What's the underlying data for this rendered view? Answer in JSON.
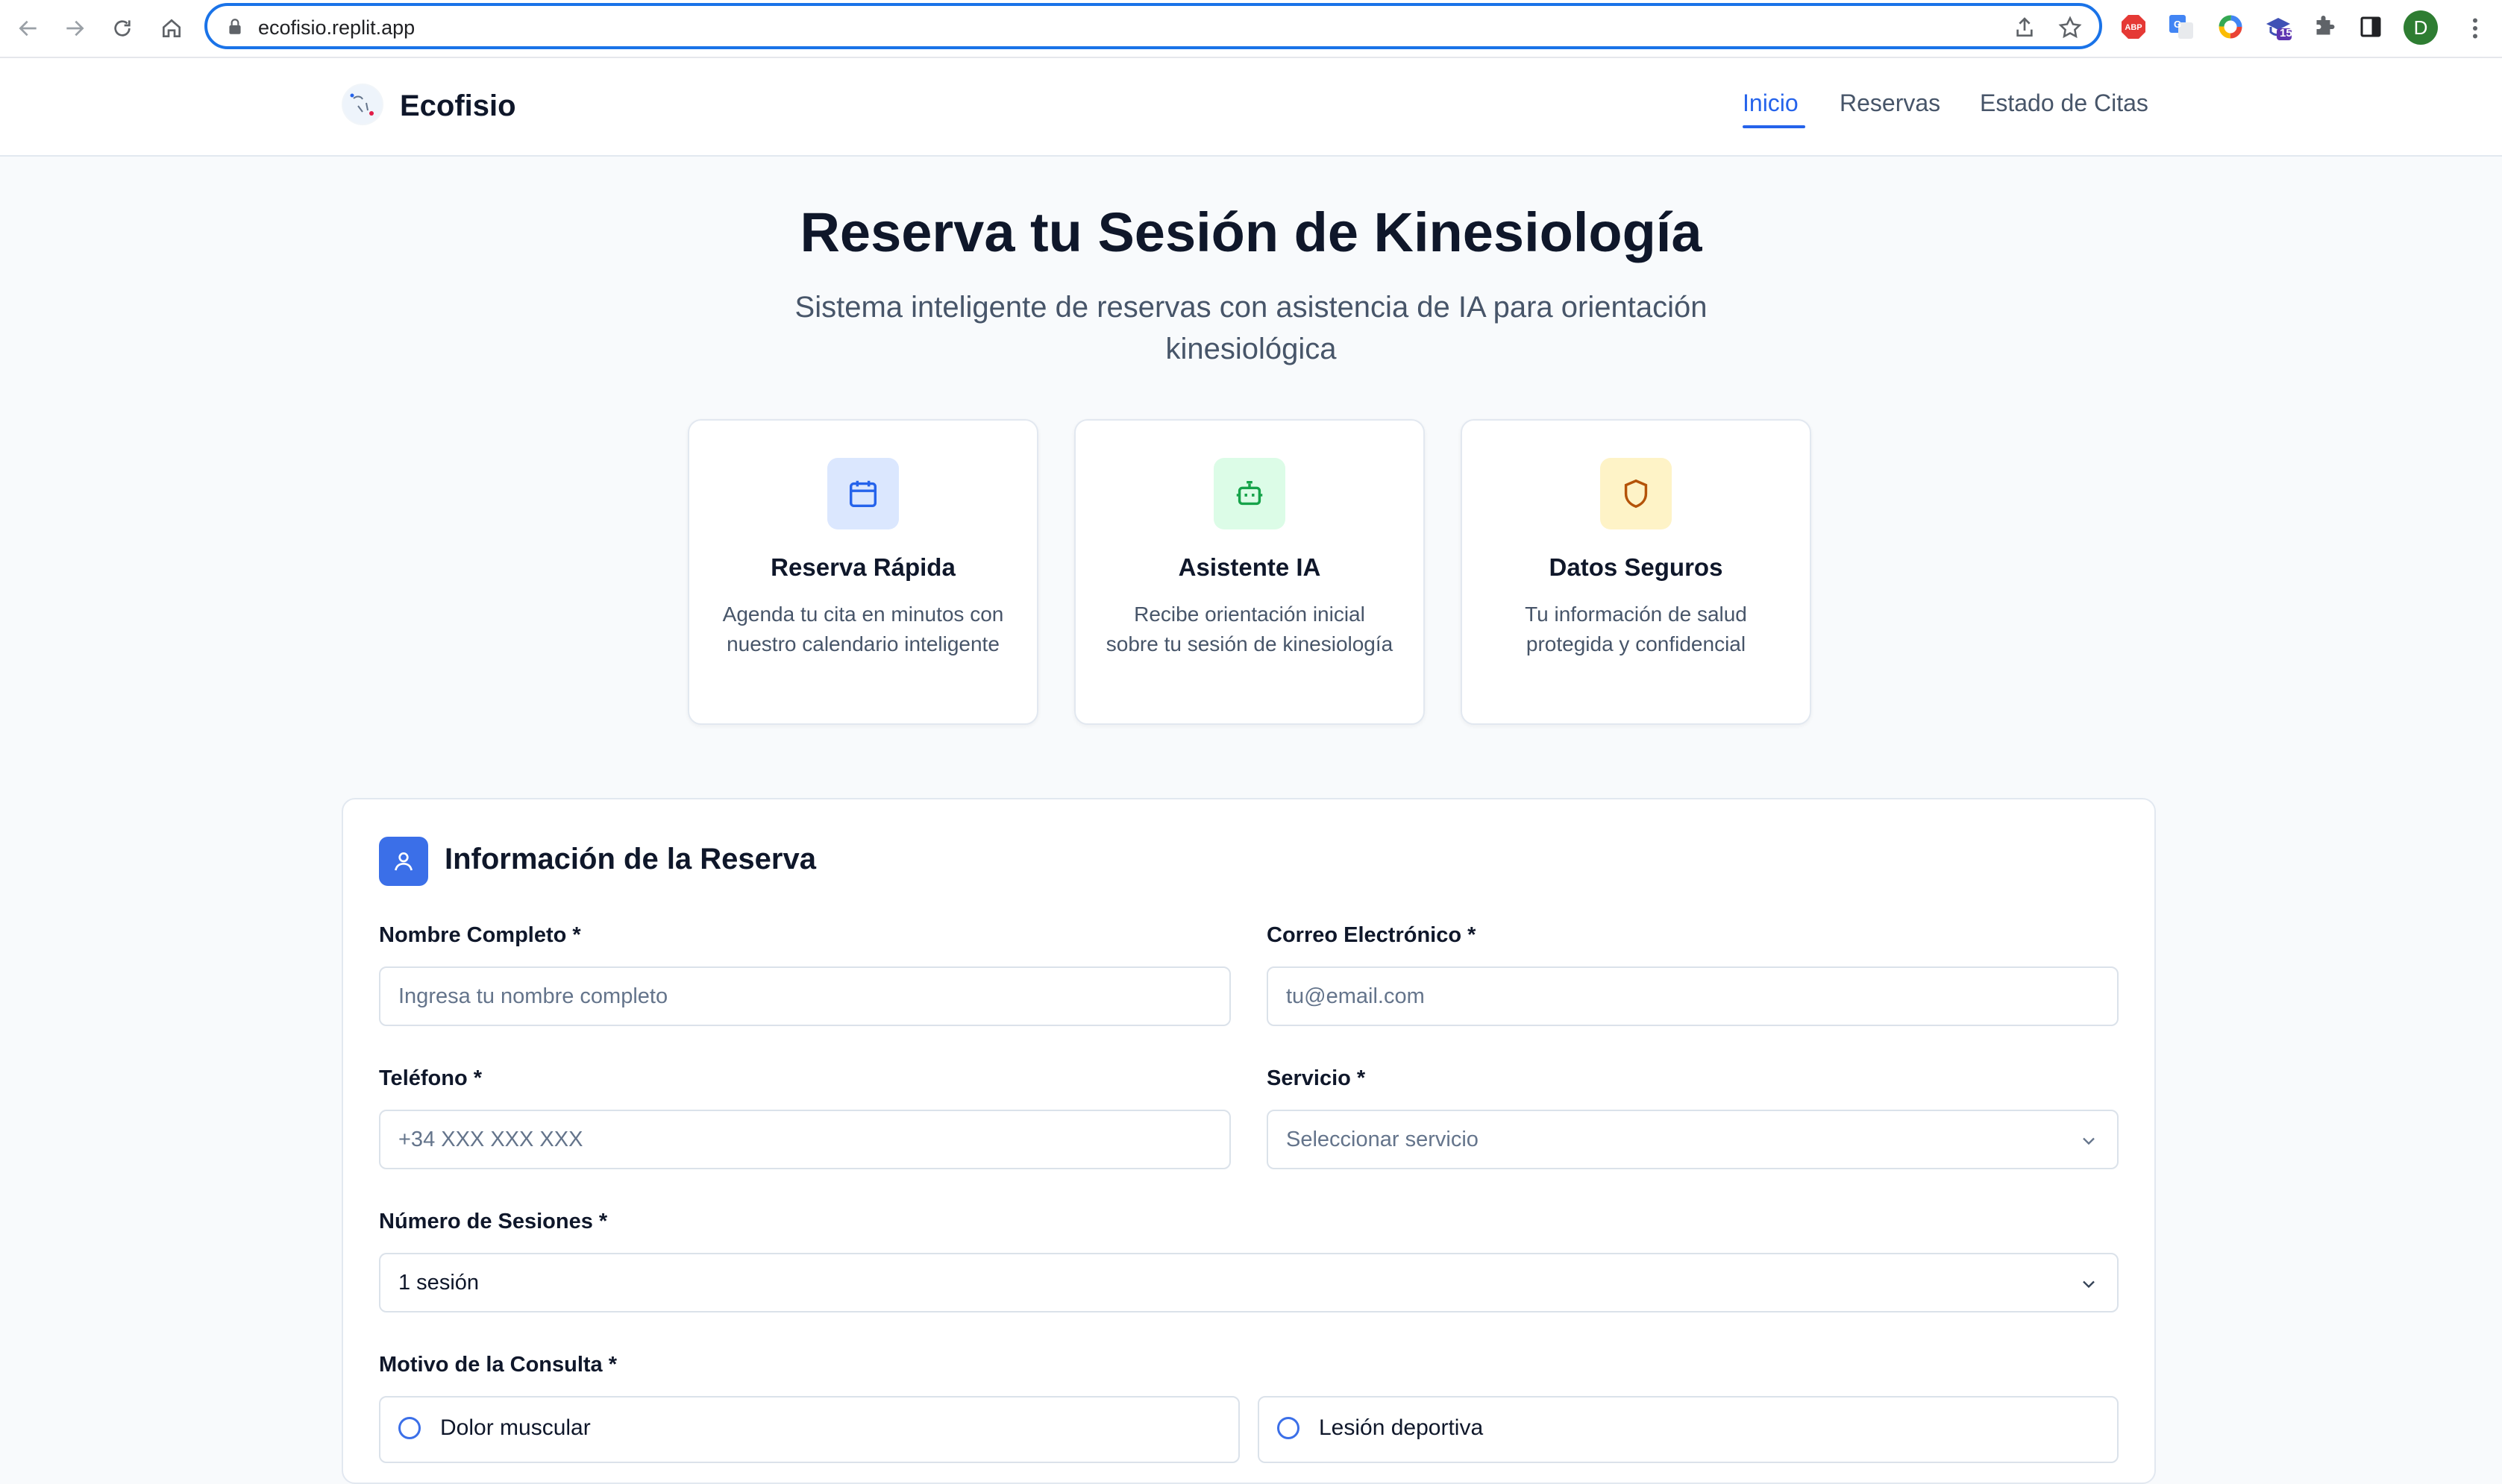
{
  "browser": {
    "url": "ecofisio.replit.app",
    "profile_initial": "D",
    "extension_badge": "15",
    "extensions": [
      "adblock-icon",
      "translate-icon",
      "color-ring-icon",
      "graduation-cap-icon",
      "puzzle-icon",
      "side-panel-icon"
    ]
  },
  "site": {
    "brand": "Ecofisio",
    "nav": [
      {
        "label": "Inicio",
        "active": true
      },
      {
        "label": "Reservas",
        "active": false
      },
      {
        "label": "Estado de Citas",
        "active": false
      }
    ]
  },
  "hero": {
    "title": "Reserva tu Sesión de Kinesiología",
    "subtitle": "Sistema inteligente de reservas con asistencia de IA para orientación kinesiológica"
  },
  "features": [
    {
      "icon": "calendar-icon",
      "title": "Reserva Rápida",
      "desc": "Agenda tu cita en minutos con nuestro calendario inteligente",
      "color": "#2563eb",
      "bg": "#dbe7fe"
    },
    {
      "icon": "robot-icon",
      "title": "Asistente IA",
      "desc": "Recibe orientación inicial sobre tu sesión de kinesiología",
      "color": "#16a34a",
      "bg": "#dcfce7"
    },
    {
      "icon": "shield-icon",
      "title": "Datos Seguros",
      "desc": "Tu información de salud protegida y confidencial",
      "color": "#b45309",
      "bg": "#fef3c7"
    }
  ],
  "form": {
    "title": "Información de la Reserva",
    "name": {
      "label": "Nombre Completo *",
      "placeholder": "Ingresa tu nombre completo"
    },
    "email": {
      "label": "Correo Electrónico *",
      "placeholder": "tu@email.com"
    },
    "phone": {
      "label": "Teléfono *",
      "placeholder": "+34 XXX XXX XXX"
    },
    "service": {
      "label": "Servicio *",
      "placeholder": "Seleccionar servicio"
    },
    "sessions": {
      "label": "Número de Sesiones *",
      "value": "1 sesión"
    },
    "reason": {
      "label": "Motivo de la Consulta *",
      "options": [
        "Dolor muscular",
        "Lesión deportiva"
      ]
    }
  },
  "colors": {
    "accent": "#2563eb",
    "form_icon_bg": "#3b6fe8"
  }
}
